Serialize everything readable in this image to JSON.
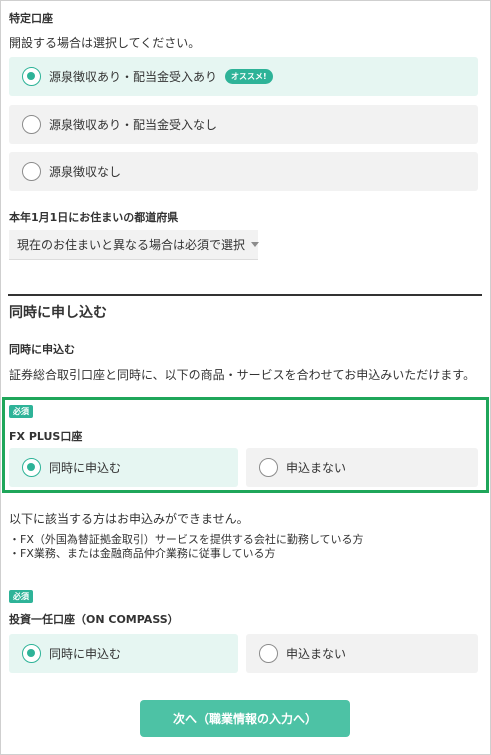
{
  "tokutei": {
    "title": "特定口座",
    "description": "開設する場合は選択してください。",
    "options": [
      {
        "label": "源泉徴収あり・配当金受入あり",
        "badge": "オススメ!"
      },
      {
        "label": "源泉徴収あり・配当金受入なし"
      },
      {
        "label": "源泉徴収なし"
      }
    ]
  },
  "prefecture": {
    "title": "本年1月1日にお住まいの都道府県",
    "value": "現在のお住まいと異なる場合は必須で選択"
  },
  "simultaneous": {
    "heading": "同時に申し込む",
    "subtitle": "同時に申込む",
    "description": "証券総合取引口座と同時に、以下の商品・サービスを合わせてお申込みいただけます。"
  },
  "fx": {
    "required": "必須",
    "title": "FX PLUS口座",
    "yes": "同時に申込む",
    "no": "申込まない",
    "note": "以下に該当する方はお申込みができません。",
    "bullet1": "・FX（外国為替証拠金取引）サービスを提供する会社に勤務している方",
    "bullet2": "・FX業務、または金融商品仲介業務に従事している方"
  },
  "compass": {
    "required": "必須",
    "title": "投資一任口座（ON COMPASS）",
    "yes": "同時に申込む",
    "no": "申込まない"
  },
  "next_button": "次へ（職業情報の入力へ）",
  "colors": {
    "accent": "#2eb398",
    "highlight_border": "#1fa65a",
    "button": "#4dc2a5"
  }
}
